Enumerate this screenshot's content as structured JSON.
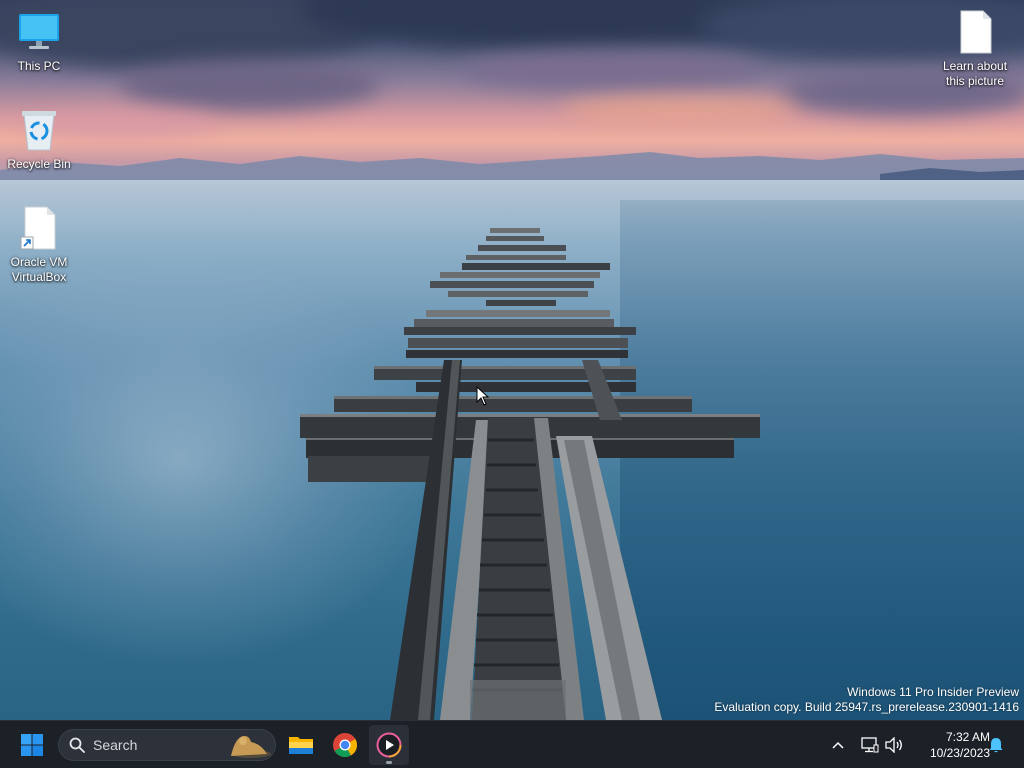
{
  "desktop": {
    "icons": [
      {
        "label": "This PC",
        "icon": "monitor-icon"
      },
      {
        "label": "Recycle Bin",
        "icon": "recycle-bin-icon"
      },
      {
        "label": "Oracle VM\nVirtualBox",
        "icon": "shortcut-file-icon"
      },
      {
        "label": "Learn about\nthis picture",
        "icon": "document-icon"
      }
    ],
    "watermark": {
      "line1": "Windows 11 Pro Insider Preview",
      "line2": "Evaluation copy. Build 25947.rs_prerelease.230901-1416"
    }
  },
  "taskbar": {
    "search_placeholder": "Search",
    "pinned": [
      "start-icon",
      "file-explorer-icon",
      "chrome-icon",
      "media-player-icon"
    ],
    "tray": {
      "time": "7:32 AM",
      "date": "10/23/2023",
      "icons": [
        "chevron-up-icon",
        "network-icon",
        "volume-icon",
        "notification-bell-icon"
      ]
    }
  },
  "colors": {
    "taskbar_bg": "#1c2027",
    "start_blue": "#1e90ff",
    "accent": "#4cc2ff"
  }
}
